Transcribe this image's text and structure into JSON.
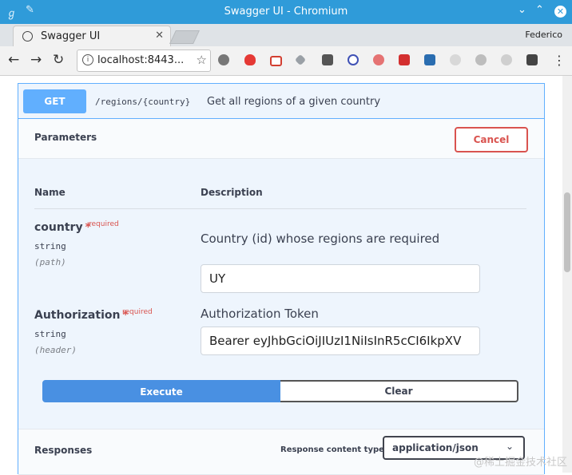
{
  "window": {
    "title": "Swagger UI - Chromium",
    "profile": "Federico"
  },
  "tab": {
    "label": "Swagger UI"
  },
  "omnibox": {
    "url": "localhost:8443..."
  },
  "operation": {
    "method": "GET",
    "path": "/regions/{country}",
    "summary": "Get all regions of a given country"
  },
  "parameters": {
    "heading": "Parameters",
    "cancel_label": "Cancel",
    "col_name": "Name",
    "col_description": "Description",
    "required_label": "required",
    "items": [
      {
        "name": "country",
        "type": "string",
        "in": "(path)",
        "description": "Country (id) whose regions are required",
        "value": "UY"
      },
      {
        "name": "Authorization",
        "type": "string",
        "in": "(header)",
        "description": "Authorization Token",
        "value": "Bearer eyJhbGciOiJIUzI1NiIsInR5cCI6IkpXV"
      }
    ]
  },
  "actions": {
    "execute_label": "Execute",
    "clear_label": "Clear"
  },
  "responses": {
    "heading": "Responses",
    "content_type_label": "Response content type",
    "content_type_value": "application/json"
  },
  "watermark": "@稀土掘金技术社区",
  "colors": {
    "get_blue": "#61affe",
    "execute_blue": "#4990e2",
    "cancel_red": "#d9534f",
    "titlebar": "#2f9bd9"
  }
}
